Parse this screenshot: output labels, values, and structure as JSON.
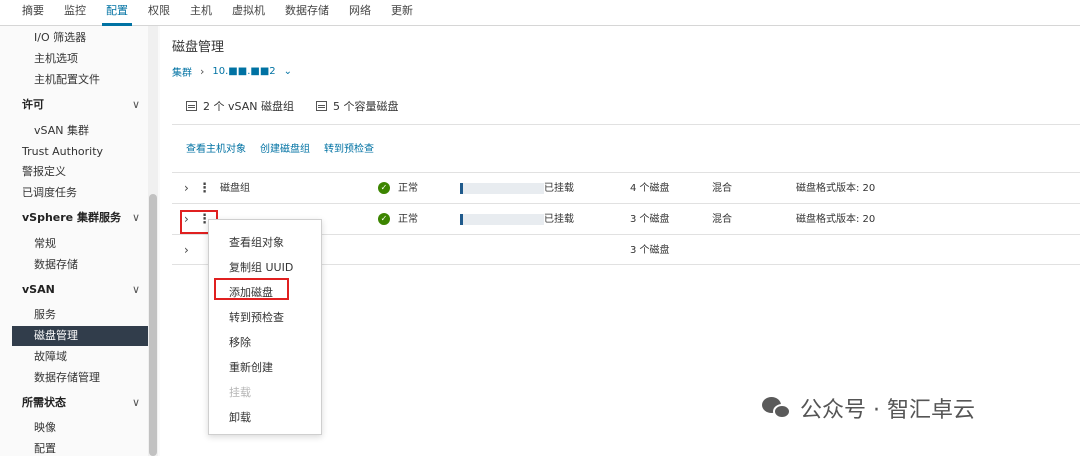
{
  "top_tabs": [
    "摘要",
    "监控",
    "配置",
    "权限",
    "主机",
    "虚拟机",
    "数据存储",
    "网络",
    "更新"
  ],
  "active_tab": "配置",
  "nav": {
    "io_filter": "I/O 筛选器",
    "host_options": "主机选项",
    "host_profile": "主机配置文件",
    "license_group": "许可",
    "vsan_cluster": "vSAN 集群",
    "trust_authority": "Trust Authority",
    "alarm_def": "警报定义",
    "scheduled_tasks": "已调度任务",
    "vsphere_group": "vSphere 集群服务",
    "general": "常规",
    "datastore": "数据存储",
    "vsan_group": "vSAN",
    "services": "服务",
    "disk_mgmt": "磁盘管理",
    "fault_domain": "故障域",
    "datastore_mgmt": "数据存储管理",
    "desired_state_group": "所需状态",
    "image": "映像",
    "config": "配置"
  },
  "main": {
    "title": "磁盘管理",
    "breadcrumb_root": "集群",
    "breadcrumb_host": "10.■■.■■2",
    "summary_groups": "2 个 vSAN 磁盘组",
    "summary_disks": "5 个容量磁盘",
    "actions": [
      "查看主机对象",
      "创建磁盘组",
      "转到预检查"
    ],
    "rows": [
      {
        "name": "磁盘组",
        "status": "正常",
        "usage": 0.03,
        "mounted": "已挂载",
        "disks": "4 个磁盘",
        "type": "混合",
        "format": "磁盘格式版本: 20"
      },
      {
        "name": "",
        "status": "正常",
        "usage": 0.03,
        "mounted": "已挂载",
        "disks": "3 个磁盘",
        "type": "混合",
        "format": "磁盘格式版本: 20"
      },
      {
        "name": "",
        "status": "",
        "usage": 0,
        "mounted": "",
        "disks": "3 个磁盘",
        "type": "",
        "format": ""
      }
    ]
  },
  "menu": {
    "view_objects": "查看组对象",
    "copy_uuid": "复制组 UUID",
    "add_disk": "添加磁盘",
    "go_precheck": "转到预检查",
    "remove": "移除",
    "recreate": "重新创建",
    "mount": "挂载",
    "unmount": "卸载"
  },
  "watermark": "公众号 · 智汇卓云",
  "colors": {
    "accent": "#0072a3",
    "selected_nav": "#313d4b",
    "ok": "#3c8500",
    "highlight": "#e02020"
  }
}
